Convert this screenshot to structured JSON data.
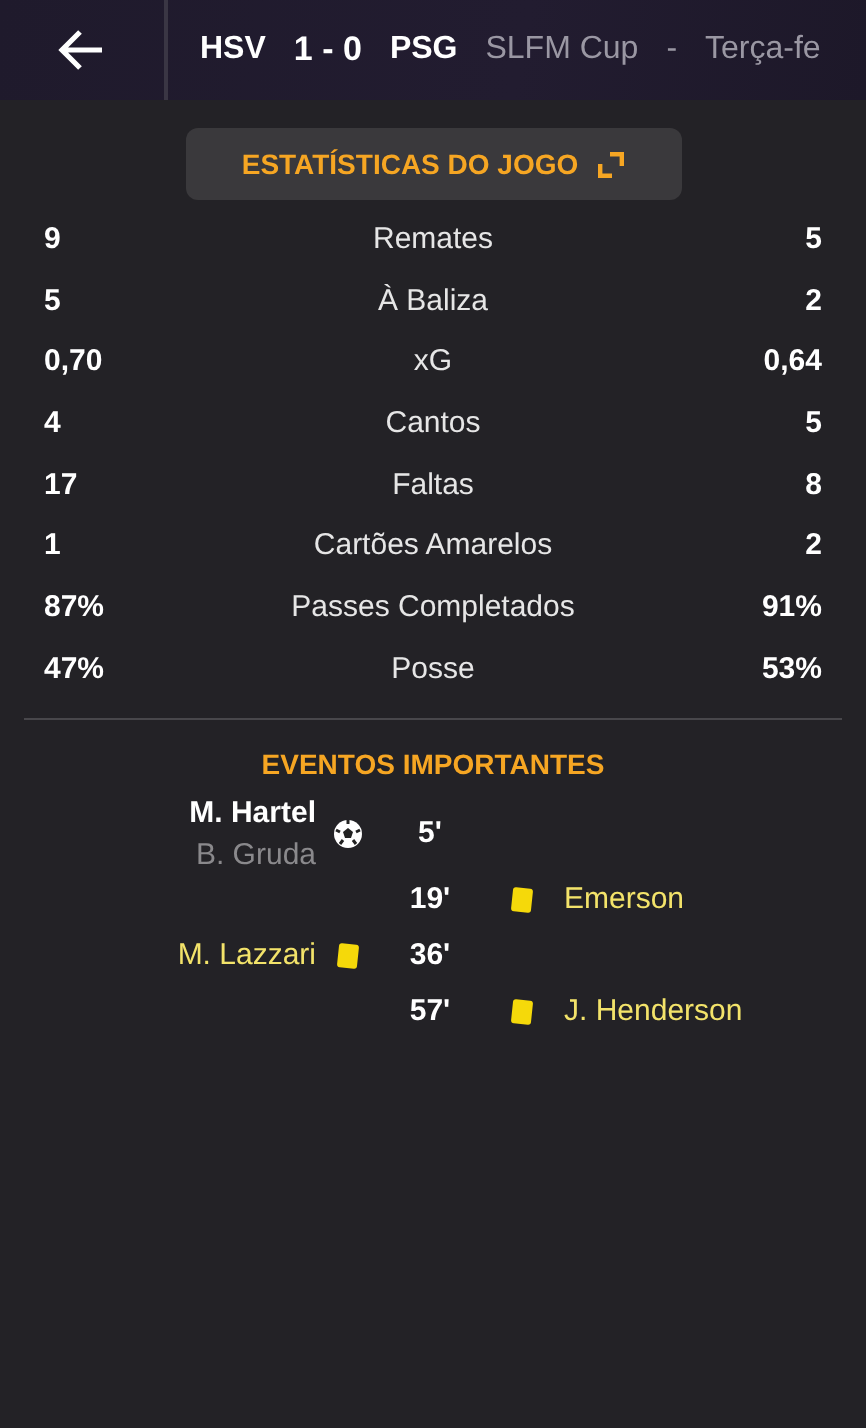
{
  "header": {
    "home": "HSV",
    "score": "1 - 0",
    "away": "PSG",
    "competition": "SLFM Cup",
    "separator": "-",
    "date": "Terça-fe"
  },
  "stats_button": {
    "label": "ESTATÍSTICAS DO JOGO"
  },
  "stats": [
    {
      "home": "9",
      "label": "Remates",
      "away": "5"
    },
    {
      "home": "5",
      "label": "À Baliza",
      "away": "2"
    },
    {
      "home": "0,70",
      "label": "xG",
      "away": "0,64"
    },
    {
      "home": "4",
      "label": "Cantos",
      "away": "5"
    },
    {
      "home": "17",
      "label": "Faltas",
      "away": "8"
    },
    {
      "home": "1",
      "label": "Cartões Amarelos",
      "away": "2"
    },
    {
      "home": "87%",
      "label": "Passes Completados",
      "away": "91%"
    },
    {
      "home": "47%",
      "label": "Posse",
      "away": "53%"
    }
  ],
  "events_title": "EVENTOS IMPORTANTES",
  "events": [
    {
      "home_side": true,
      "kind": "goal",
      "minute": "5'",
      "player": "M. Hartel",
      "assist": "B. Gruda"
    },
    {
      "home_side": false,
      "kind": "yellow",
      "minute": "19'",
      "player": "Emerson"
    },
    {
      "home_side": true,
      "kind": "yellow",
      "minute": "36'",
      "player": "M. Lazzari"
    },
    {
      "home_side": false,
      "kind": "yellow",
      "minute": "57'",
      "player": "J. Henderson"
    }
  ]
}
